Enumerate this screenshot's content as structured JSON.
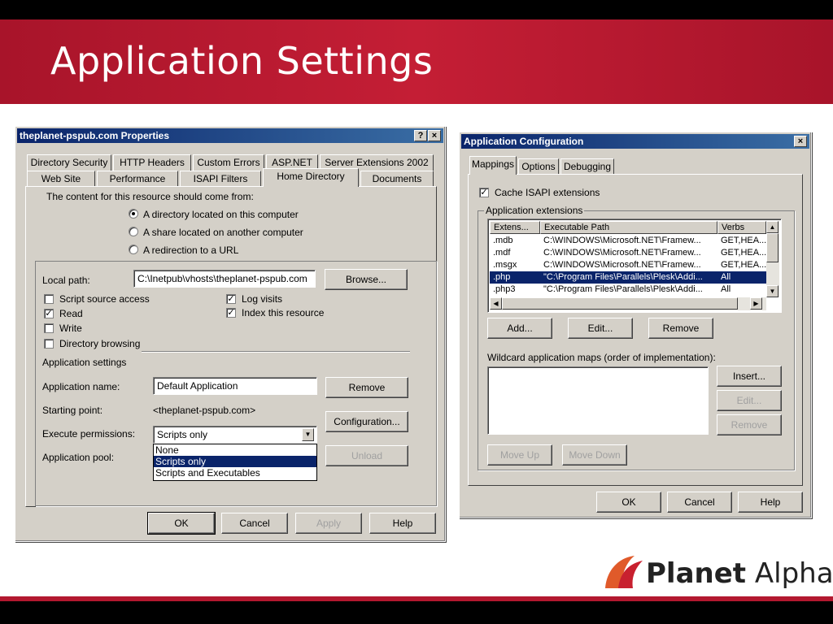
{
  "slide": {
    "title": "Application Settings",
    "brand_bold": "Planet",
    "brand_light": "Alpha"
  },
  "props_dialog": {
    "title": "theplanet-pspub.com Properties",
    "help_btn": "?",
    "close_btn": "×",
    "tabs_row1": [
      "Directory Security",
      "HTTP Headers",
      "Custom Errors",
      "ASP.NET",
      "Server Extensions 2002"
    ],
    "tabs_row2": [
      "Web Site",
      "Performance",
      "ISAPI Filters",
      "Home Directory",
      "Documents"
    ],
    "content_source_label": "The content for this resource should come from:",
    "source_options": [
      "A directory located on this computer",
      "A share located on another computer",
      "A redirection to a URL"
    ],
    "local_path_label": "Local path:",
    "local_path_value": "C:\\Inetpub\\vhosts\\theplanet-pspub.com",
    "browse_btn": "Browse...",
    "checks": {
      "script_source": "Script source access",
      "read": "Read",
      "write": "Write",
      "dir_browsing": "Directory browsing",
      "log_visits": "Log visits",
      "index_resource": "Index this resource"
    },
    "check_mark": "✓",
    "app_settings_label": "Application settings",
    "app_name_label": "Application name:",
    "app_name_value": "Default Application",
    "remove_btn": "Remove",
    "starting_point_label": "Starting point:",
    "starting_point_value": "<theplanet-pspub.com>",
    "config_btn": "Configuration...",
    "exec_perm_label": "Execute permissions:",
    "exec_perm_value": "Scripts only",
    "exec_options": [
      "None",
      "Scripts only",
      "Scripts and Executables"
    ],
    "app_pool_label": "Application pool:",
    "unload_btn": "Unload",
    "ok_btn": "OK",
    "cancel_btn": "Cancel",
    "apply_btn": "Apply",
    "help_btn_label": "Help",
    "dropdown_arrow": "▼"
  },
  "config_dialog": {
    "title": "Application Configuration",
    "close_btn": "×",
    "tabs": [
      "Mappings",
      "Options",
      "Debugging"
    ],
    "cache_isapi": "Cache ISAPI extensions",
    "app_ext_label": "Application extensions",
    "columns": [
      "Extens...",
      "Executable Path",
      "Verbs"
    ],
    "rows": [
      {
        "ext": ".mdb",
        "path": "C:\\WINDOWS\\Microsoft.NET\\Framew...",
        "verbs": "GET,HEA..."
      },
      {
        "ext": ".mdf",
        "path": "C:\\WINDOWS\\Microsoft.NET\\Framew...",
        "verbs": "GET,HEA..."
      },
      {
        "ext": ".msgx",
        "path": "C:\\WINDOWS\\Microsoft.NET\\Framew...",
        "verbs": "GET,HEA..."
      },
      {
        "ext": ".php",
        "path": "\"C:\\Program Files\\Parallels\\Plesk\\Addi...",
        "verbs": "All"
      },
      {
        "ext": ".php3",
        "path": "\"C:\\Program Files\\Parallels\\Plesk\\Addi...",
        "verbs": "All"
      }
    ],
    "add_btn": "Add...",
    "edit_btn": "Edit...",
    "remove_btn": "Remove",
    "wildcard_label": "Wildcard application maps (order of implementation):",
    "insert_btn": "Insert...",
    "wild_edit_btn": "Edit...",
    "wild_remove_btn": "Remove",
    "move_up_btn": "Move Up",
    "move_down_btn": "Move Down",
    "ok_btn": "OK",
    "cancel_btn": "Cancel",
    "help_btn": "Help",
    "arrow_up": "▲",
    "arrow_down": "▼",
    "arrow_left": "◀",
    "arrow_right": "▶"
  }
}
